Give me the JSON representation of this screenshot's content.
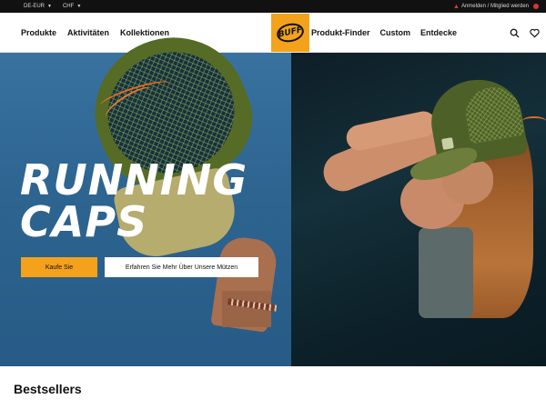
{
  "topbar": {
    "region": "DE-EUR",
    "currency": "CHF",
    "account_link": "Anmelden / Mitglied werden"
  },
  "nav": {
    "left": [
      "Produkte",
      "Aktivitäten",
      "Kollektionen"
    ],
    "logo_text": "BUFF",
    "right": [
      "Produkt-Finder",
      "Custom",
      "Entdecke"
    ],
    "icons": [
      "search-icon",
      "wishlist-heart-icon"
    ]
  },
  "hero": {
    "title_line1": "RUNNING",
    "title_line2": "CAPS",
    "primary_button": "Kaufe Sie",
    "secondary_button": "Erfahren Sie Mehr Über Unsere Mützen"
  },
  "section": {
    "title": "Bestsellers"
  },
  "colors": {
    "accent": "#f4a21b",
    "topbar_bg": "#111111",
    "hero_left_bg": "#2f6a96"
  }
}
